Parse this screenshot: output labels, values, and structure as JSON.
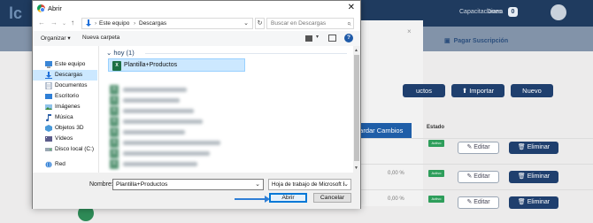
{
  "background_app": {
    "nav_capacitaciones": "Capacitaciones",
    "nav_diana": "Diana",
    "badge": "0",
    "pagar_suscripcion": "Pagar Suscripción",
    "btn_productos": "uctos",
    "btn_importar": "Importar",
    "btn_nuevo": "Nuevo",
    "guardar_cambios": "uardar Cambios",
    "estado_header": "Estado",
    "active_badge": "Activo",
    "pct": "0,00 %",
    "editar": "Editar",
    "eliminar": "Eliminar"
  },
  "dialog": {
    "title": "Abrir",
    "address": {
      "segment1": "Este equipo",
      "segment2": "Descargas"
    },
    "search_placeholder": "Buscar en Descargas",
    "toolbar": {
      "organize": "Organizar",
      "new_folder": "Nueva carpeta",
      "help": "?"
    },
    "sidebar": [
      {
        "label": "Este equipo",
        "icon": "computer-icon",
        "selected": false
      },
      {
        "label": "Descargas",
        "icon": "downloads-icon",
        "selected": true
      },
      {
        "label": "Documentos",
        "icon": "documents-icon",
        "selected": false
      },
      {
        "label": "Escritorio",
        "icon": "desktop-icon",
        "selected": false
      },
      {
        "label": "Imágenes",
        "icon": "pictures-icon",
        "selected": false
      },
      {
        "label": "Música",
        "icon": "music-icon",
        "selected": false
      },
      {
        "label": "Objetos 3D",
        "icon": "objects3d-icon",
        "selected": false
      },
      {
        "label": "Vídeos",
        "icon": "videos-icon",
        "selected": false
      },
      {
        "label": "Disco local (C:)",
        "icon": "drive-icon",
        "selected": false
      },
      {
        "label": "Red",
        "icon": "network-icon",
        "selected": false
      }
    ],
    "group_header": "hoy (1)",
    "selected_file": "Plantilla+Productos",
    "file_name_label": "Nombre:",
    "file_name_value": "Plantilla+Productos",
    "file_type": "Hoja de trabajo de Microsoft Ex",
    "open_button": "Abrir",
    "cancel_button": "Cancelar"
  },
  "colors": {
    "accent": "#0078d7",
    "app_header": "#1f3b5f",
    "app_button": "#1f3f6e",
    "excel_green": "#1d7044",
    "annotation_arrow": "#2f7fd6"
  }
}
